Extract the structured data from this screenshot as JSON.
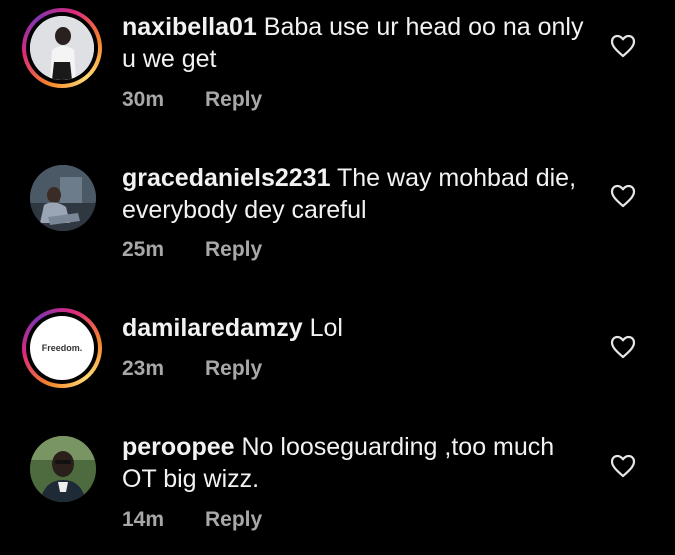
{
  "comments": [
    {
      "username": "naxibella01",
      "text": "Baba use ur head oo na only u we get",
      "time": "30m",
      "reply_label": "Reply",
      "has_story_ring": true,
      "avatar_icon": "profile-photo"
    },
    {
      "username": "gracedaniels2231",
      "text": "The way mohbad die, everybody dey careful",
      "time": "25m",
      "reply_label": "Reply",
      "has_story_ring": false,
      "avatar_icon": "profile-photo"
    },
    {
      "username": "damilaredamzy",
      "text": "Lol",
      "time": "23m",
      "reply_label": "Reply",
      "has_story_ring": true,
      "avatar_text": "Freedom.",
      "avatar_icon": "profile-photo"
    },
    {
      "username": "peroopee",
      "text": "No looseguarding ,too much OT big wizz.",
      "time": "14m",
      "reply_label": "Reply",
      "has_story_ring": false,
      "avatar_icon": "profile-photo"
    }
  ],
  "colors": {
    "background": "#000000",
    "text": "#f2f2f2",
    "meta": "#a8a8a8",
    "story_ring": [
      "#f58529",
      "#dd2a7b",
      "#8134af"
    ]
  },
  "icons": {
    "like": "heart-outline-icon"
  }
}
